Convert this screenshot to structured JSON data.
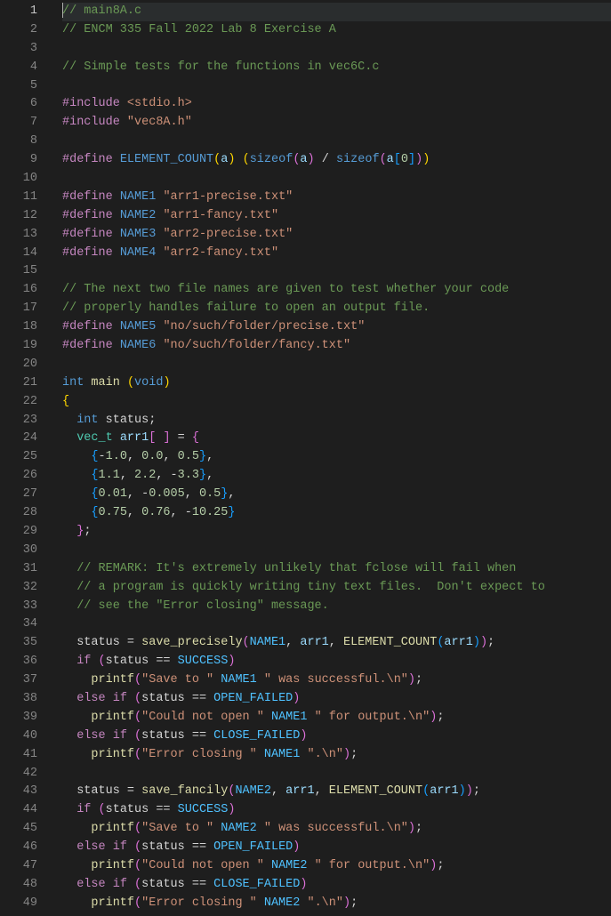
{
  "file": "main8A.c",
  "lines": [
    {
      "n": 1,
      "current": true,
      "tokens": [
        {
          "t": "// main8A.c",
          "c": "c-comment",
          "cursor": true
        }
      ]
    },
    {
      "n": 2,
      "tokens": [
        {
          "t": "// ENCM 335 Fall 2022 Lab 8 Exercise A",
          "c": "c-comment"
        }
      ]
    },
    {
      "n": 3,
      "tokens": []
    },
    {
      "n": 4,
      "tokens": [
        {
          "t": "// Simple tests for the functions in vec6C.c",
          "c": "c-comment"
        }
      ]
    },
    {
      "n": 5,
      "tokens": []
    },
    {
      "n": 6,
      "tokens": [
        {
          "t": "#include",
          "c": "c-pp"
        },
        {
          "t": " "
        },
        {
          "t": "<stdio.h>",
          "c": "c-str"
        }
      ]
    },
    {
      "n": 7,
      "tokens": [
        {
          "t": "#include",
          "c": "c-pp"
        },
        {
          "t": " "
        },
        {
          "t": "\"vec8A.h\"",
          "c": "c-str"
        }
      ]
    },
    {
      "n": 8,
      "tokens": []
    },
    {
      "n": 9,
      "tokens": [
        {
          "t": "#define",
          "c": "c-pp"
        },
        {
          "t": " "
        },
        {
          "t": "ELEMENT_COUNT",
          "c": "c-macro"
        },
        {
          "t": "(",
          "c": "c-brace"
        },
        {
          "t": "a",
          "c": "c-var"
        },
        {
          "t": ")",
          "c": "c-brace"
        },
        {
          "t": " "
        },
        {
          "t": "(",
          "c": "c-brace"
        },
        {
          "t": "sizeof",
          "c": "c-kw"
        },
        {
          "t": "(",
          "c": "c-brace2"
        },
        {
          "t": "a",
          "c": "c-var"
        },
        {
          "t": ")",
          "c": "c-brace2"
        },
        {
          "t": " / ",
          "c": "c-op"
        },
        {
          "t": "sizeof",
          "c": "c-kw"
        },
        {
          "t": "(",
          "c": "c-brace2"
        },
        {
          "t": "a",
          "c": "c-var"
        },
        {
          "t": "[",
          "c": "c-brace3"
        },
        {
          "t": "0",
          "c": "c-num"
        },
        {
          "t": "]",
          "c": "c-brace3"
        },
        {
          "t": ")",
          "c": "c-brace2"
        },
        {
          "t": ")",
          "c": "c-brace"
        }
      ]
    },
    {
      "n": 10,
      "tokens": []
    },
    {
      "n": 11,
      "tokens": [
        {
          "t": "#define",
          "c": "c-pp"
        },
        {
          "t": " "
        },
        {
          "t": "NAME1",
          "c": "c-macro"
        },
        {
          "t": " "
        },
        {
          "t": "\"arr1-precise.txt\"",
          "c": "c-str"
        }
      ]
    },
    {
      "n": 12,
      "tokens": [
        {
          "t": "#define",
          "c": "c-pp"
        },
        {
          "t": " "
        },
        {
          "t": "NAME2",
          "c": "c-macro"
        },
        {
          "t": " "
        },
        {
          "t": "\"arr1-fancy.txt\"",
          "c": "c-str"
        }
      ]
    },
    {
      "n": 13,
      "tokens": [
        {
          "t": "#define",
          "c": "c-pp"
        },
        {
          "t": " "
        },
        {
          "t": "NAME3",
          "c": "c-macro"
        },
        {
          "t": " "
        },
        {
          "t": "\"arr2-precise.txt\"",
          "c": "c-str"
        }
      ]
    },
    {
      "n": 14,
      "tokens": [
        {
          "t": "#define",
          "c": "c-pp"
        },
        {
          "t": " "
        },
        {
          "t": "NAME4",
          "c": "c-macro"
        },
        {
          "t": " "
        },
        {
          "t": "\"arr2-fancy.txt\"",
          "c": "c-str"
        }
      ]
    },
    {
      "n": 15,
      "tokens": []
    },
    {
      "n": 16,
      "tokens": [
        {
          "t": "// The next two file names are given to test whether your code",
          "c": "c-comment"
        }
      ]
    },
    {
      "n": 17,
      "tokens": [
        {
          "t": "// properly handles failure to open an output file.",
          "c": "c-comment"
        }
      ]
    },
    {
      "n": 18,
      "tokens": [
        {
          "t": "#define",
          "c": "c-pp"
        },
        {
          "t": " "
        },
        {
          "t": "NAME5",
          "c": "c-macro"
        },
        {
          "t": " "
        },
        {
          "t": "\"no/such/folder/precise.txt\"",
          "c": "c-str"
        }
      ]
    },
    {
      "n": 19,
      "tokens": [
        {
          "t": "#define",
          "c": "c-pp"
        },
        {
          "t": " "
        },
        {
          "t": "NAME6",
          "c": "c-macro"
        },
        {
          "t": " "
        },
        {
          "t": "\"no/such/folder/fancy.txt\"",
          "c": "c-str"
        }
      ]
    },
    {
      "n": 20,
      "tokens": []
    },
    {
      "n": 21,
      "tokens": [
        {
          "t": "int",
          "c": "c-kw"
        },
        {
          "t": " "
        },
        {
          "t": "main",
          "c": "c-fn"
        },
        {
          "t": " "
        },
        {
          "t": "(",
          "c": "c-brace"
        },
        {
          "t": "void",
          "c": "c-kw"
        },
        {
          "t": ")",
          "c": "c-brace"
        }
      ]
    },
    {
      "n": 22,
      "tokens": [
        {
          "t": "{",
          "c": "c-brace"
        }
      ]
    },
    {
      "n": 23,
      "tokens": [
        {
          "t": "  "
        },
        {
          "t": "int",
          "c": "c-kw"
        },
        {
          "t": " status;"
        }
      ]
    },
    {
      "n": 24,
      "tokens": [
        {
          "t": "  "
        },
        {
          "t": "vec_t",
          "c": "c-type"
        },
        {
          "t": " "
        },
        {
          "t": "arr1",
          "c": "c-var"
        },
        {
          "t": "[",
          "c": "c-brace2"
        },
        {
          "t": " "
        },
        {
          "t": "]",
          "c": "c-brace2"
        },
        {
          "t": " = "
        },
        {
          "t": "{",
          "c": "c-brace2"
        }
      ]
    },
    {
      "n": 25,
      "tokens": [
        {
          "t": "    "
        },
        {
          "t": "{",
          "c": "c-brace3"
        },
        {
          "t": "-",
          "c": "c-op"
        },
        {
          "t": "1.0",
          "c": "c-num"
        },
        {
          "t": ", "
        },
        {
          "t": "0.0",
          "c": "c-num"
        },
        {
          "t": ", "
        },
        {
          "t": "0.5",
          "c": "c-num"
        },
        {
          "t": "}",
          "c": "c-brace3"
        },
        {
          "t": ","
        }
      ]
    },
    {
      "n": 26,
      "tokens": [
        {
          "t": "    "
        },
        {
          "t": "{",
          "c": "c-brace3"
        },
        {
          "t": "1.1",
          "c": "c-num"
        },
        {
          "t": ", "
        },
        {
          "t": "2.2",
          "c": "c-num"
        },
        {
          "t": ", "
        },
        {
          "t": "-",
          "c": "c-op"
        },
        {
          "t": "3.3",
          "c": "c-num"
        },
        {
          "t": "}",
          "c": "c-brace3"
        },
        {
          "t": ","
        }
      ]
    },
    {
      "n": 27,
      "tokens": [
        {
          "t": "    "
        },
        {
          "t": "{",
          "c": "c-brace3"
        },
        {
          "t": "0.01",
          "c": "c-num"
        },
        {
          "t": ", "
        },
        {
          "t": "-",
          "c": "c-op"
        },
        {
          "t": "0.005",
          "c": "c-num"
        },
        {
          "t": ", "
        },
        {
          "t": "0.5",
          "c": "c-num"
        },
        {
          "t": "}",
          "c": "c-brace3"
        },
        {
          "t": ","
        }
      ]
    },
    {
      "n": 28,
      "tokens": [
        {
          "t": "    "
        },
        {
          "t": "{",
          "c": "c-brace3"
        },
        {
          "t": "0.75",
          "c": "c-num"
        },
        {
          "t": ", "
        },
        {
          "t": "0.76",
          "c": "c-num"
        },
        {
          "t": ", "
        },
        {
          "t": "-",
          "c": "c-op"
        },
        {
          "t": "10.25",
          "c": "c-num"
        },
        {
          "t": "}",
          "c": "c-brace3"
        }
      ]
    },
    {
      "n": 29,
      "tokens": [
        {
          "t": "  "
        },
        {
          "t": "}",
          "c": "c-brace2"
        },
        {
          "t": ";"
        }
      ]
    },
    {
      "n": 30,
      "tokens": []
    },
    {
      "n": 31,
      "tokens": [
        {
          "t": "  "
        },
        {
          "t": "// REMARK: It's extremely unlikely that fclose will fail when",
          "c": "c-comment"
        }
      ]
    },
    {
      "n": 32,
      "tokens": [
        {
          "t": "  "
        },
        {
          "t": "// a program is quickly writing tiny text files.  Don't expect to",
          "c": "c-comment"
        }
      ]
    },
    {
      "n": 33,
      "tokens": [
        {
          "t": "  "
        },
        {
          "t": "// see the \"Error closing\" message.",
          "c": "c-comment"
        }
      ]
    },
    {
      "n": 34,
      "tokens": []
    },
    {
      "n": 35,
      "tokens": [
        {
          "t": "  status = "
        },
        {
          "t": "save_precisely",
          "c": "c-fn"
        },
        {
          "t": "(",
          "c": "c-brace2"
        },
        {
          "t": "NAME1",
          "c": "c-const"
        },
        {
          "t": ", "
        },
        {
          "t": "arr1",
          "c": "c-var"
        },
        {
          "t": ", "
        },
        {
          "t": "ELEMENT_COUNT",
          "c": "c-fn"
        },
        {
          "t": "(",
          "c": "c-brace3"
        },
        {
          "t": "arr1",
          "c": "c-var"
        },
        {
          "t": ")",
          "c": "c-brace3"
        },
        {
          "t": ")",
          "c": "c-brace2"
        },
        {
          "t": ";"
        }
      ]
    },
    {
      "n": 36,
      "tokens": [
        {
          "t": "  "
        },
        {
          "t": "if",
          "c": "c-pp"
        },
        {
          "t": " "
        },
        {
          "t": "(",
          "c": "c-brace2"
        },
        {
          "t": "status == "
        },
        {
          "t": "SUCCESS",
          "c": "c-const"
        },
        {
          "t": ")",
          "c": "c-brace2"
        }
      ]
    },
    {
      "n": 37,
      "tokens": [
        {
          "t": "    "
        },
        {
          "t": "printf",
          "c": "c-fn"
        },
        {
          "t": "(",
          "c": "c-brace2"
        },
        {
          "t": "\"Save to \"",
          "c": "c-str"
        },
        {
          "t": " "
        },
        {
          "t": "NAME1",
          "c": "c-const"
        },
        {
          "t": " "
        },
        {
          "t": "\" was successful.\\n\"",
          "c": "c-str"
        },
        {
          "t": ")",
          "c": "c-brace2"
        },
        {
          "t": ";"
        }
      ]
    },
    {
      "n": 38,
      "tokens": [
        {
          "t": "  "
        },
        {
          "t": "else",
          "c": "c-pp"
        },
        {
          "t": " "
        },
        {
          "t": "if",
          "c": "c-pp"
        },
        {
          "t": " "
        },
        {
          "t": "(",
          "c": "c-brace2"
        },
        {
          "t": "status == "
        },
        {
          "t": "OPEN_FAILED",
          "c": "c-const"
        },
        {
          "t": ")",
          "c": "c-brace2"
        }
      ]
    },
    {
      "n": 39,
      "tokens": [
        {
          "t": "    "
        },
        {
          "t": "printf",
          "c": "c-fn"
        },
        {
          "t": "(",
          "c": "c-brace2"
        },
        {
          "t": "\"Could not open \"",
          "c": "c-str"
        },
        {
          "t": " "
        },
        {
          "t": "NAME1",
          "c": "c-const"
        },
        {
          "t": " "
        },
        {
          "t": "\" for output.\\n\"",
          "c": "c-str"
        },
        {
          "t": ")",
          "c": "c-brace2"
        },
        {
          "t": ";"
        }
      ]
    },
    {
      "n": 40,
      "tokens": [
        {
          "t": "  "
        },
        {
          "t": "else",
          "c": "c-pp"
        },
        {
          "t": " "
        },
        {
          "t": "if",
          "c": "c-pp"
        },
        {
          "t": " "
        },
        {
          "t": "(",
          "c": "c-brace2"
        },
        {
          "t": "status == "
        },
        {
          "t": "CLOSE_FAILED",
          "c": "c-const"
        },
        {
          "t": ")",
          "c": "c-brace2"
        }
      ]
    },
    {
      "n": 41,
      "tokens": [
        {
          "t": "    "
        },
        {
          "t": "printf",
          "c": "c-fn"
        },
        {
          "t": "(",
          "c": "c-brace2"
        },
        {
          "t": "\"Error closing \"",
          "c": "c-str"
        },
        {
          "t": " "
        },
        {
          "t": "NAME1",
          "c": "c-const"
        },
        {
          "t": " "
        },
        {
          "t": "\".\\n\"",
          "c": "c-str"
        },
        {
          "t": ")",
          "c": "c-brace2"
        },
        {
          "t": ";"
        }
      ]
    },
    {
      "n": 42,
      "tokens": []
    },
    {
      "n": 43,
      "tokens": [
        {
          "t": "  status = "
        },
        {
          "t": "save_fancily",
          "c": "c-fn"
        },
        {
          "t": "(",
          "c": "c-brace2"
        },
        {
          "t": "NAME2",
          "c": "c-const"
        },
        {
          "t": ", "
        },
        {
          "t": "arr1",
          "c": "c-var"
        },
        {
          "t": ", "
        },
        {
          "t": "ELEMENT_COUNT",
          "c": "c-fn"
        },
        {
          "t": "(",
          "c": "c-brace3"
        },
        {
          "t": "arr1",
          "c": "c-var"
        },
        {
          "t": ")",
          "c": "c-brace3"
        },
        {
          "t": ")",
          "c": "c-brace2"
        },
        {
          "t": ";"
        }
      ]
    },
    {
      "n": 44,
      "tokens": [
        {
          "t": "  "
        },
        {
          "t": "if",
          "c": "c-pp"
        },
        {
          "t": " "
        },
        {
          "t": "(",
          "c": "c-brace2"
        },
        {
          "t": "status == "
        },
        {
          "t": "SUCCESS",
          "c": "c-const"
        },
        {
          "t": ")",
          "c": "c-brace2"
        }
      ]
    },
    {
      "n": 45,
      "tokens": [
        {
          "t": "    "
        },
        {
          "t": "printf",
          "c": "c-fn"
        },
        {
          "t": "(",
          "c": "c-brace2"
        },
        {
          "t": "\"Save to \"",
          "c": "c-str"
        },
        {
          "t": " "
        },
        {
          "t": "NAME2",
          "c": "c-const"
        },
        {
          "t": " "
        },
        {
          "t": "\" was successful.\\n\"",
          "c": "c-str"
        },
        {
          "t": ")",
          "c": "c-brace2"
        },
        {
          "t": ";"
        }
      ]
    },
    {
      "n": 46,
      "tokens": [
        {
          "t": "  "
        },
        {
          "t": "else",
          "c": "c-pp"
        },
        {
          "t": " "
        },
        {
          "t": "if",
          "c": "c-pp"
        },
        {
          "t": " "
        },
        {
          "t": "(",
          "c": "c-brace2"
        },
        {
          "t": "status == "
        },
        {
          "t": "OPEN_FAILED",
          "c": "c-const"
        },
        {
          "t": ")",
          "c": "c-brace2"
        }
      ]
    },
    {
      "n": 47,
      "tokens": [
        {
          "t": "    "
        },
        {
          "t": "printf",
          "c": "c-fn"
        },
        {
          "t": "(",
          "c": "c-brace2"
        },
        {
          "t": "\"Could not open \"",
          "c": "c-str"
        },
        {
          "t": " "
        },
        {
          "t": "NAME2",
          "c": "c-const"
        },
        {
          "t": " "
        },
        {
          "t": "\" for output.\\n\"",
          "c": "c-str"
        },
        {
          "t": ")",
          "c": "c-brace2"
        },
        {
          "t": ";"
        }
      ]
    },
    {
      "n": 48,
      "tokens": [
        {
          "t": "  "
        },
        {
          "t": "else",
          "c": "c-pp"
        },
        {
          "t": " "
        },
        {
          "t": "if",
          "c": "c-pp"
        },
        {
          "t": " "
        },
        {
          "t": "(",
          "c": "c-brace2"
        },
        {
          "t": "status == "
        },
        {
          "t": "CLOSE_FAILED",
          "c": "c-const"
        },
        {
          "t": ")",
          "c": "c-brace2"
        }
      ]
    },
    {
      "n": 49,
      "tokens": [
        {
          "t": "    "
        },
        {
          "t": "printf",
          "c": "c-fn"
        },
        {
          "t": "(",
          "c": "c-brace2"
        },
        {
          "t": "\"Error closing \"",
          "c": "c-str"
        },
        {
          "t": " "
        },
        {
          "t": "NAME2",
          "c": "c-const"
        },
        {
          "t": " "
        },
        {
          "t": "\".\\n\"",
          "c": "c-str"
        },
        {
          "t": ")",
          "c": "c-brace2"
        },
        {
          "t": ";"
        }
      ]
    }
  ]
}
